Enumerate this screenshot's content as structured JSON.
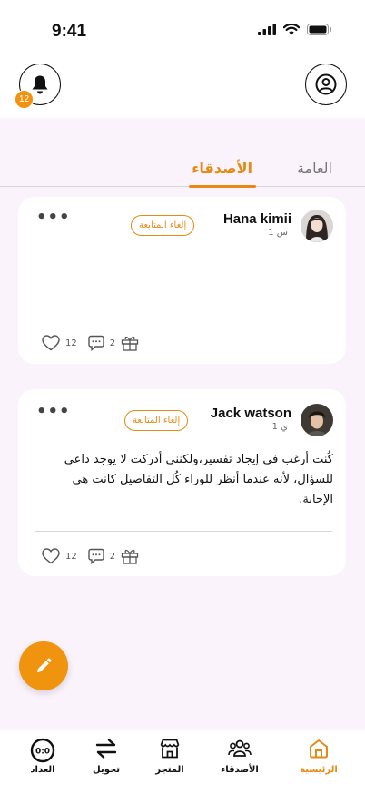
{
  "status": {
    "time": "9:41"
  },
  "header": {
    "notification_count": "12"
  },
  "tabs": {
    "friends": "الأصدقاء",
    "general": "العامة"
  },
  "posts": [
    {
      "name": "Hana kimii",
      "time": "1 س",
      "unfollow_label": "إلغاء المتابعة",
      "text": "",
      "likes": "12",
      "comments": "2"
    },
    {
      "name": "Jack watson",
      "time": "1 ي",
      "unfollow_label": "إلغاء المتابعة",
      "text": "كُنت أرغب في إيجاد تفسير،ولكنني أدركت لا يوجد داعي للسؤال، لأنه عندما أنظر للوراء كُل التفاصيل كانت هي الإجابة.",
      "likes": "12",
      "comments": "2"
    }
  ],
  "bottom_nav": {
    "home": "الرئيسية",
    "friends": "الأصدقاء",
    "store": "المتجر",
    "transfer": "تحويل",
    "counter": "العداد"
  },
  "colors": {
    "accent": "#e58a14",
    "background": "#fbf3fc"
  }
}
